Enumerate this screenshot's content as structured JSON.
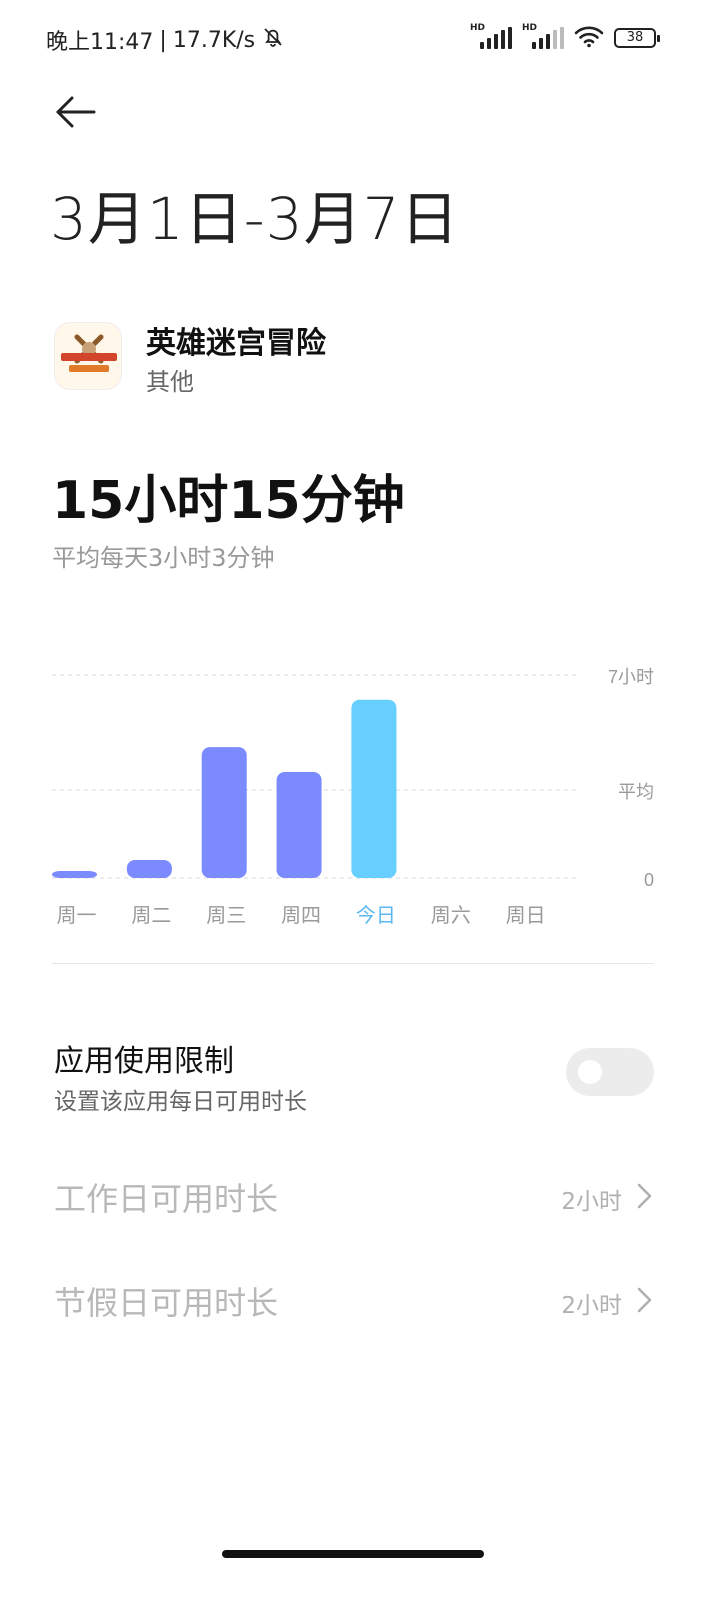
{
  "status": {
    "time": "晚上11:47",
    "separator": "|",
    "speed": "17.7K/s",
    "hd1": "HD",
    "hd2": "HD",
    "battery": "38"
  },
  "header": {
    "date_range": "3月1日-3月7日"
  },
  "app": {
    "name": "英雄迷宫冒险",
    "category": "其他"
  },
  "usage": {
    "total": "15小时15分钟",
    "average": "平均每天3小时3分钟"
  },
  "chart_data": {
    "type": "bar",
    "categories": [
      "周一",
      "周二",
      "周三",
      "周四",
      "今日",
      "周六",
      "周日"
    ],
    "values": [
      0.1,
      0.4,
      2.9,
      2.35,
      3.95,
      0,
      0
    ],
    "y_ticks": [
      "7小时",
      "平均",
      "0"
    ],
    "ylim": [
      0,
      4.5
    ],
    "avg_value": 1.95,
    "highlight_index": 4,
    "colors": {
      "normal": "#7b8bff",
      "highlight": "#66cfff",
      "today_label": "#5bb8f0"
    }
  },
  "limit": {
    "title": "应用使用限制",
    "subtitle": "设置该应用每日可用时长"
  },
  "rows": [
    {
      "label": "工作日可用时长",
      "value": "2小时"
    },
    {
      "label": "节假日可用时长",
      "value": "2小时"
    }
  ]
}
